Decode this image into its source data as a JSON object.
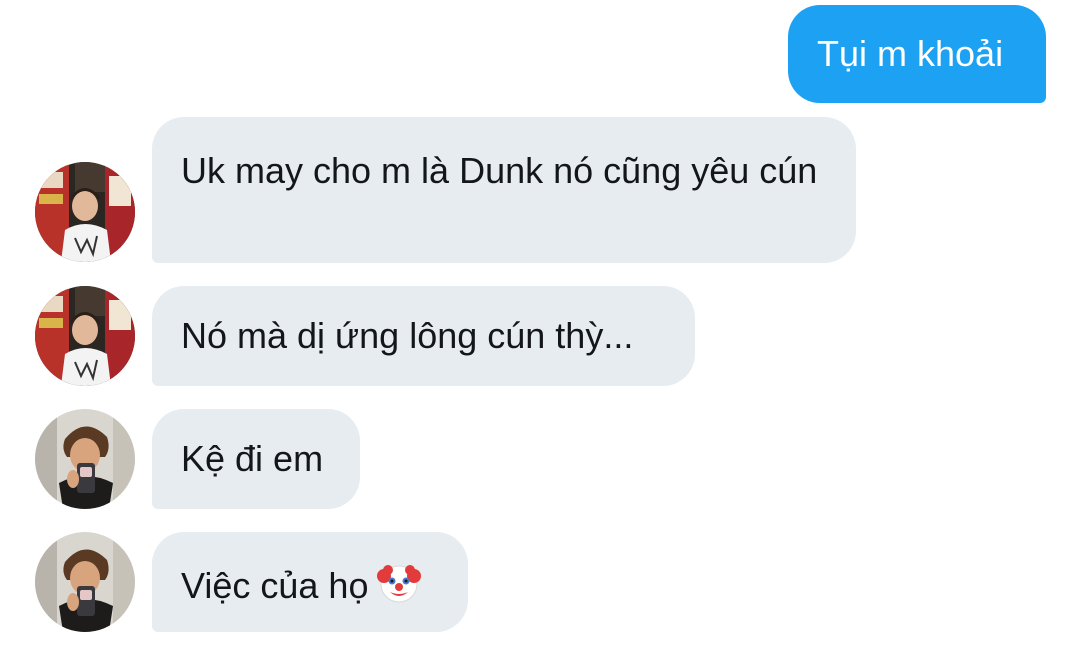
{
  "messages": [
    {
      "direction": "outgoing",
      "text": "Tụi m khoải"
    },
    {
      "direction": "incoming",
      "text": "Uk may cho m là Dunk nó cũng yêu cún"
    },
    {
      "direction": "incoming",
      "text": "Nó mà dị ứng lông cún thỳ..."
    },
    {
      "direction": "incoming",
      "text": "Kệ đi em"
    },
    {
      "direction": "incoming",
      "text": "Việc của họ",
      "emoji": "clown-face-icon"
    }
  ],
  "colors": {
    "outgoing_bubble": "#1da1f2",
    "incoming_bubble": "#e6ecf0",
    "outgoing_text": "#ffffff",
    "incoming_text": "#14171a"
  }
}
